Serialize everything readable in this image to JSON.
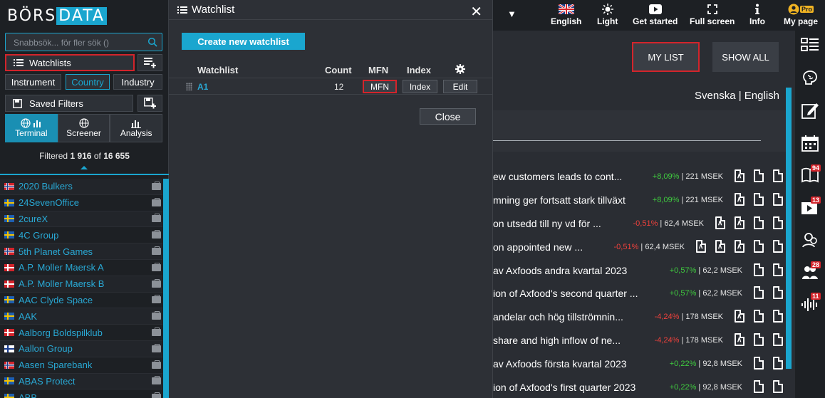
{
  "brand": {
    "left": "BÖRS",
    "right": "DATA"
  },
  "sidebar": {
    "search_placeholder": "Snabbsök... för fler sök ()",
    "watchlists_label": "Watchlists",
    "tabs": [
      "Instrument",
      "Country",
      "Industry"
    ],
    "saved_filters_label": "Saved Filters",
    "modes": [
      "Terminal",
      "Screener",
      "Analysis"
    ],
    "filtered_prefix": "Filtered",
    "filtered_count": "1 916",
    "filtered_of": "of",
    "filtered_total": "16 655",
    "items": [
      {
        "name": "2020 Bulkers",
        "flag": "NO"
      },
      {
        "name": "24SevenOffice",
        "flag": "SE"
      },
      {
        "name": "2cureX",
        "flag": "SE"
      },
      {
        "name": "4C Group",
        "flag": "SE"
      },
      {
        "name": "5th Planet Games",
        "flag": "NO"
      },
      {
        "name": "A.P. Moller Maersk A",
        "flag": "DK"
      },
      {
        "name": "A.P. Moller Maersk B",
        "flag": "DK"
      },
      {
        "name": "AAC Clyde Space",
        "flag": "SE"
      },
      {
        "name": "AAK",
        "flag": "SE"
      },
      {
        "name": "Aalborg Boldspilklub",
        "flag": "DK"
      },
      {
        "name": "Aallon Group",
        "flag": "FI"
      },
      {
        "name": "Aasen Sparebank",
        "flag": "NO"
      },
      {
        "name": "ABAS Protect",
        "flag": "SE"
      },
      {
        "name": "ABB",
        "flag": "SE"
      }
    ]
  },
  "watchlist_panel": {
    "title": "Watchlist",
    "create_label": "Create new watchlist",
    "columns": {
      "watchlist": "Watchlist",
      "count": "Count",
      "mfn": "MFN",
      "index": "Index"
    },
    "row": {
      "name": "A1",
      "count": "12",
      "mfn_btn": "MFN",
      "index_btn": "Index",
      "edit_btn": "Edit"
    },
    "close_label": "Close"
  },
  "topbar": {
    "items": [
      {
        "label": "English",
        "icon": "uk-flag-icon"
      },
      {
        "label": "Light",
        "icon": "sun-icon"
      },
      {
        "label": "Get started",
        "icon": "play-icon"
      },
      {
        "label": "Full screen",
        "icon": "fullscreen-icon"
      },
      {
        "label": "Info",
        "icon": "info-icon"
      },
      {
        "label": "My page",
        "icon": "user-icon",
        "badge": "Pro"
      }
    ]
  },
  "main": {
    "my_list": "MY LIST",
    "show_all": "SHOW ALL",
    "lang_sv": "Svenska",
    "lang_sep": "|",
    "lang_en": "English",
    "news": [
      {
        "text": "ew customers leads to cont...",
        "change": "+8,09%",
        "cap": "221 MSEK",
        "docs": 3
      },
      {
        "text": "mning ger fortsatt stark tillväxt",
        "change": "+8,09%",
        "cap": "221 MSEK",
        "docs": 3
      },
      {
        "text": "on utsedd till ny vd för ...",
        "change": "-0,51%",
        "cap": "62,4 MSEK",
        "docs": 4
      },
      {
        "text": "on appointed new ...",
        "change": "-0,51%",
        "cap": "62,4 MSEK",
        "docs": 5
      },
      {
        "text": "av Axfoods andra kvartal 2023",
        "change": "+0,57%",
        "cap": "62,2 MSEK",
        "docs": 2
      },
      {
        "text": "ion of Axfood's second quarter ...",
        "change": "+0,57%",
        "cap": "62,2 MSEK",
        "docs": 2
      },
      {
        "text": "andelar och hög tillströmnin...",
        "change": "-4,24%",
        "cap": "178 MSEK",
        "docs": 3
      },
      {
        "text": "share and high inflow of ne...",
        "change": "-4,24%",
        "cap": "178 MSEK",
        "docs": 3
      },
      {
        "text": "av Axfoods första kvartal 2023",
        "change": "+0,22%",
        "cap": "92,8 MSEK",
        "docs": 2
      },
      {
        "text": "ion of Axfood's first quarter 2023",
        "change": "+0,22%",
        "cap": "92,8 MSEK",
        "docs": 2
      }
    ]
  },
  "right_bar": {
    "badges": {
      "book": "94",
      "video": "13",
      "people": "28",
      "audio": "11"
    }
  },
  "colors": {
    "accent": "#1aa6cf",
    "highlight": "#d3242b",
    "positive": "#3fca3f",
    "negative": "#f0413c"
  }
}
